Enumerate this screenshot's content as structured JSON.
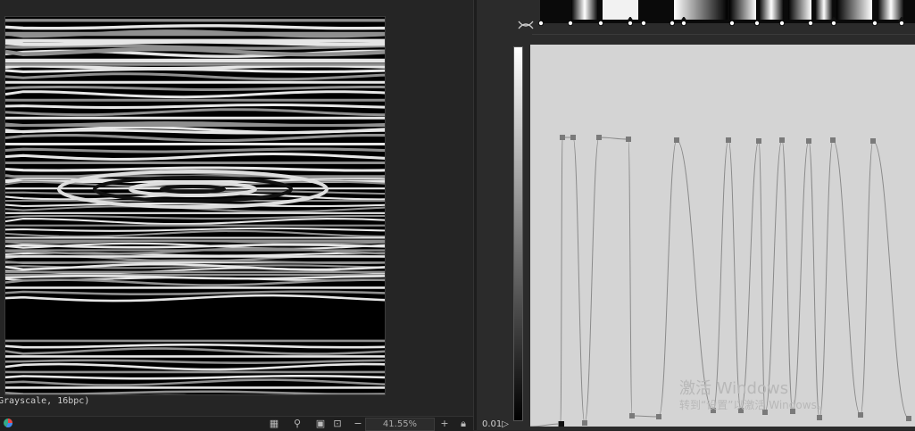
{
  "status": {
    "text": "Grayscale, 16bpc)"
  },
  "toolbar": {
    "zoom": "41.55%",
    "zoom_out": "−",
    "zoom_in": "+"
  },
  "curve_editor": {
    "min_label": "0.01▷"
  },
  "watermark": {
    "title": "激活 Windows",
    "subtitle": "转到“设置”以激活 Windows。"
  },
  "colors": {
    "panel": "#252525",
    "curve_bg": "#d4d4d4",
    "curve_stroke": "#8a8a8a",
    "point": "#7a7a7a"
  },
  "icons": [
    "color-wheel-icon",
    "grid-icon",
    "pin-icon",
    "crop-icon",
    "transform-icon",
    "zoom-out-icon",
    "zoom-in-icon",
    "lock-icon",
    "gradient-ramp-icon"
  ]
}
